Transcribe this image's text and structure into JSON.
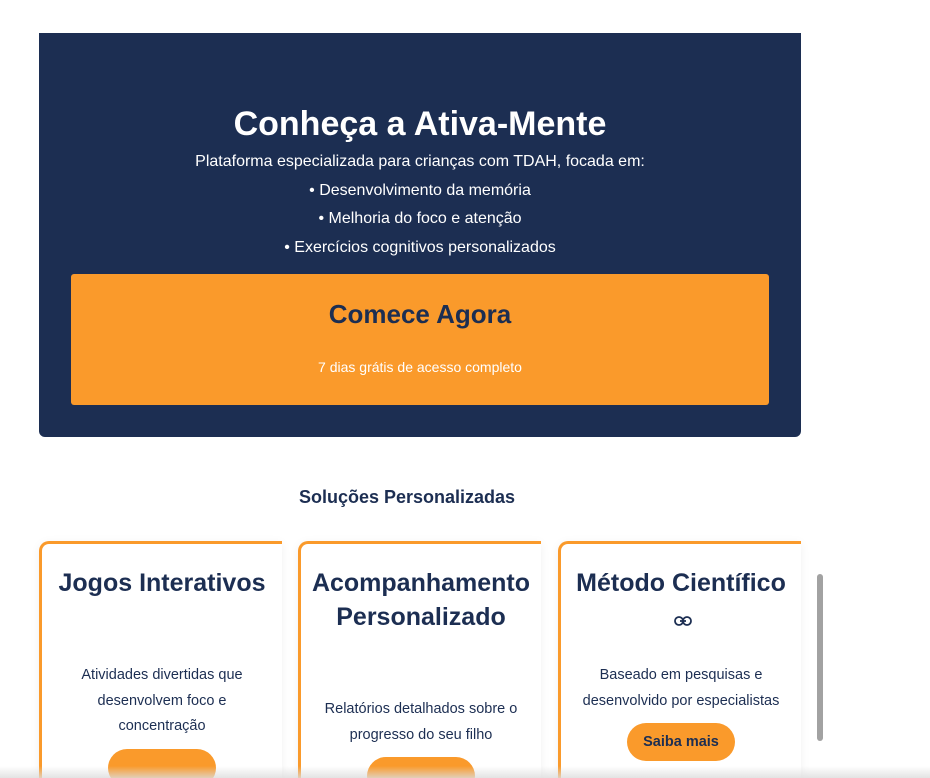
{
  "hero": {
    "title": "Conheça a Ativa-Mente",
    "description": "Plataforma especializada para crianças com TDAH, focada em:",
    "bullets": [
      "• Desenvolvimento da memória",
      "• Melhoria do foco e atenção",
      "• Exercícios cognitivos personalizados"
    ],
    "cta_label": "Comece Agora",
    "cta_sub": "7 dias grátis de acesso completo"
  },
  "solutions": {
    "title": "Soluções Personalizadas",
    "cards": [
      {
        "title": "Jogos Interativos",
        "text": "Atividades divertidas que desenvolvem foco e concentração"
      },
      {
        "title": "Acompanhamento Personalizado",
        "text": "Relatórios detalhados sobre o progresso do seu filho"
      },
      {
        "title": "Método Científico",
        "text": "Baseado em pesquisas e desenvolvido por especialistas",
        "button": "Saiba mais",
        "icon": "link-icon"
      }
    ]
  },
  "colors": {
    "navy": "#1c2e52",
    "orange": "#fa9a2b",
    "white": "#ffffff"
  }
}
